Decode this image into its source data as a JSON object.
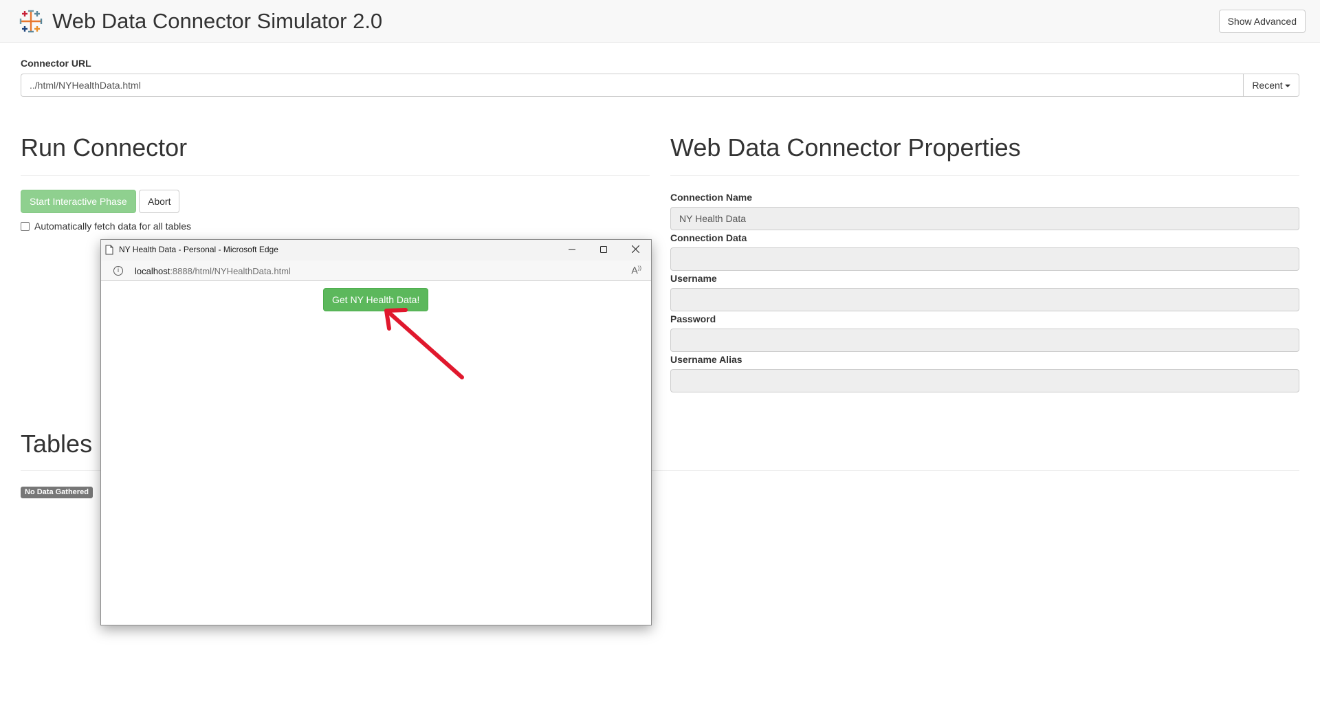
{
  "app": {
    "title": "Web Data Connector Simulator 2.0",
    "show_advanced_label": "Show Advanced",
    "logo_icon": "tableau-logo-icon"
  },
  "connector_url": {
    "label": "Connector URL",
    "value": "../html/NYHealthData.html",
    "recent_label": "Recent"
  },
  "run_connector": {
    "heading": "Run Connector",
    "start_label": "Start Interactive Phase",
    "abort_label": "Abort",
    "auto_fetch_label": "Automatically fetch data for all tables",
    "auto_fetch_checked": false
  },
  "properties": {
    "heading": "Web Data Connector Properties",
    "fields": [
      {
        "label": "Connection Name",
        "value": "NY Health Data"
      },
      {
        "label": "Connection Data",
        "value": ""
      },
      {
        "label": "Username",
        "value": ""
      },
      {
        "label": "Password",
        "value": ""
      },
      {
        "label": "Username Alias",
        "value": ""
      }
    ]
  },
  "tables": {
    "heading": "Tables",
    "badge": "No Data Gathered"
  },
  "popup": {
    "title": "NY Health Data - Personal - Microsoft Edge",
    "address_host": "localhost",
    "address_path": ":8888/html/NYHealthData.html",
    "button_label": "Get NY Health Data!",
    "controls": [
      "minimize-icon",
      "maximize-icon",
      "close-icon"
    ]
  },
  "colors": {
    "accent_green": "#5cb85c",
    "disabled_green": "#8fd08f",
    "annotation_arrow": "#e0182d",
    "badge_gray": "#777777"
  }
}
